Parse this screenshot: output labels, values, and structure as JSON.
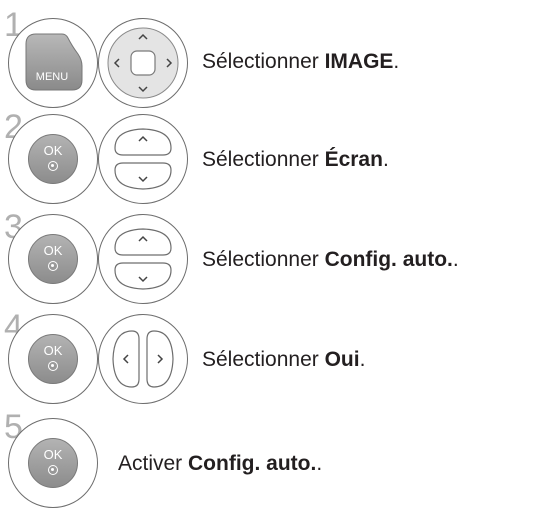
{
  "steps": [
    {
      "number": "1",
      "button": "MENU",
      "pad": "4-way",
      "text": "Sélectionner ",
      "bold": "IMAGE",
      "suffix": "."
    },
    {
      "number": "2",
      "button": "OK",
      "pad": "up-down",
      "text": "Sélectionner ",
      "bold": "Écran",
      "suffix": "."
    },
    {
      "number": "3",
      "button": "OK",
      "pad": "up-down",
      "text": "Sélectionner ",
      "bold": "Config. auto.",
      "suffix": "."
    },
    {
      "number": "4",
      "button": "OK",
      "pad": "left-right",
      "text": "Sélectionner ",
      "bold": "Oui",
      "suffix": "."
    },
    {
      "number": "5",
      "button": "OK",
      "pad": "none",
      "text": "Activer ",
      "bold": "Config. auto.",
      "suffix": "."
    }
  ],
  "colors": {
    "step_number": "#b0b0b0",
    "button_fill": "#9e9e9e",
    "outline": "#6d6d6d",
    "text": "#231f20"
  }
}
